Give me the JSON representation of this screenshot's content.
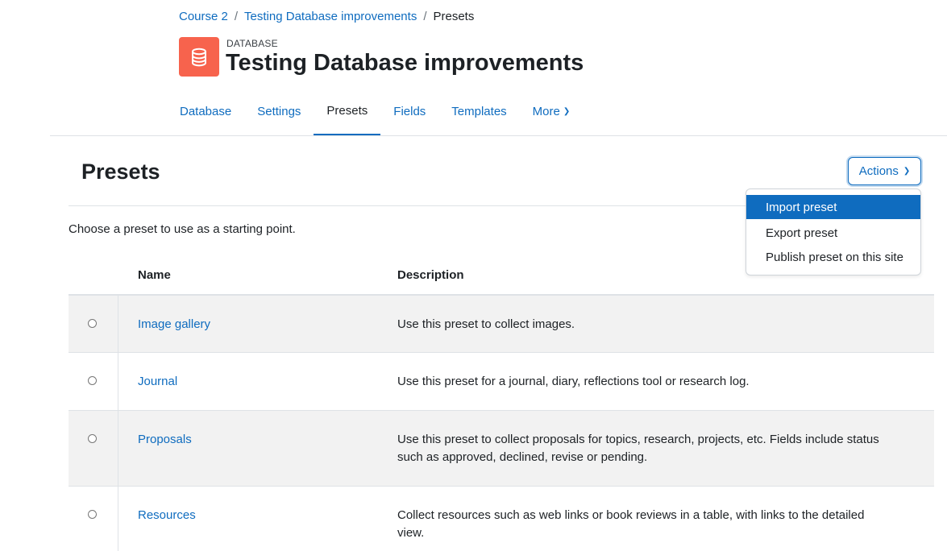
{
  "breadcrumb": {
    "item1": "Course 2",
    "item2": "Testing Database improvements",
    "current": "Presets",
    "separator": "/"
  },
  "module": {
    "type_label": "DATABASE",
    "title": "Testing Database improvements",
    "icon": "database-icon",
    "icon_color": "#f7634d"
  },
  "secondary_nav": {
    "tabs": [
      "Database",
      "Settings",
      "Presets",
      "Fields",
      "Templates",
      "More"
    ],
    "active": "Presets"
  },
  "main": {
    "heading": "Presets",
    "actions_label": "Actions",
    "intro": "Choose a preset to use as a starting point.",
    "actions_menu": [
      "Import preset",
      "Export preset",
      "Publish preset on this site"
    ],
    "table": {
      "headers": {
        "name": "Name",
        "description": "Description"
      },
      "rows": [
        {
          "name": "Image gallery",
          "description": "Use this preset to collect images."
        },
        {
          "name": "Journal",
          "description": "Use this preset for a journal, diary, reflections tool or research log."
        },
        {
          "name": "Proposals",
          "description": "Use this preset to collect proposals for topics, research, projects, etc. Fields include status such as approved, declined, revise or pending."
        },
        {
          "name": "Resources",
          "description": "Collect resources such as web links or book reviews in a table, with links to the detailed view."
        }
      ]
    }
  },
  "colors": {
    "link": "#0f6cbf",
    "accent": "#0f6cbf",
    "text": "#1d2125"
  }
}
